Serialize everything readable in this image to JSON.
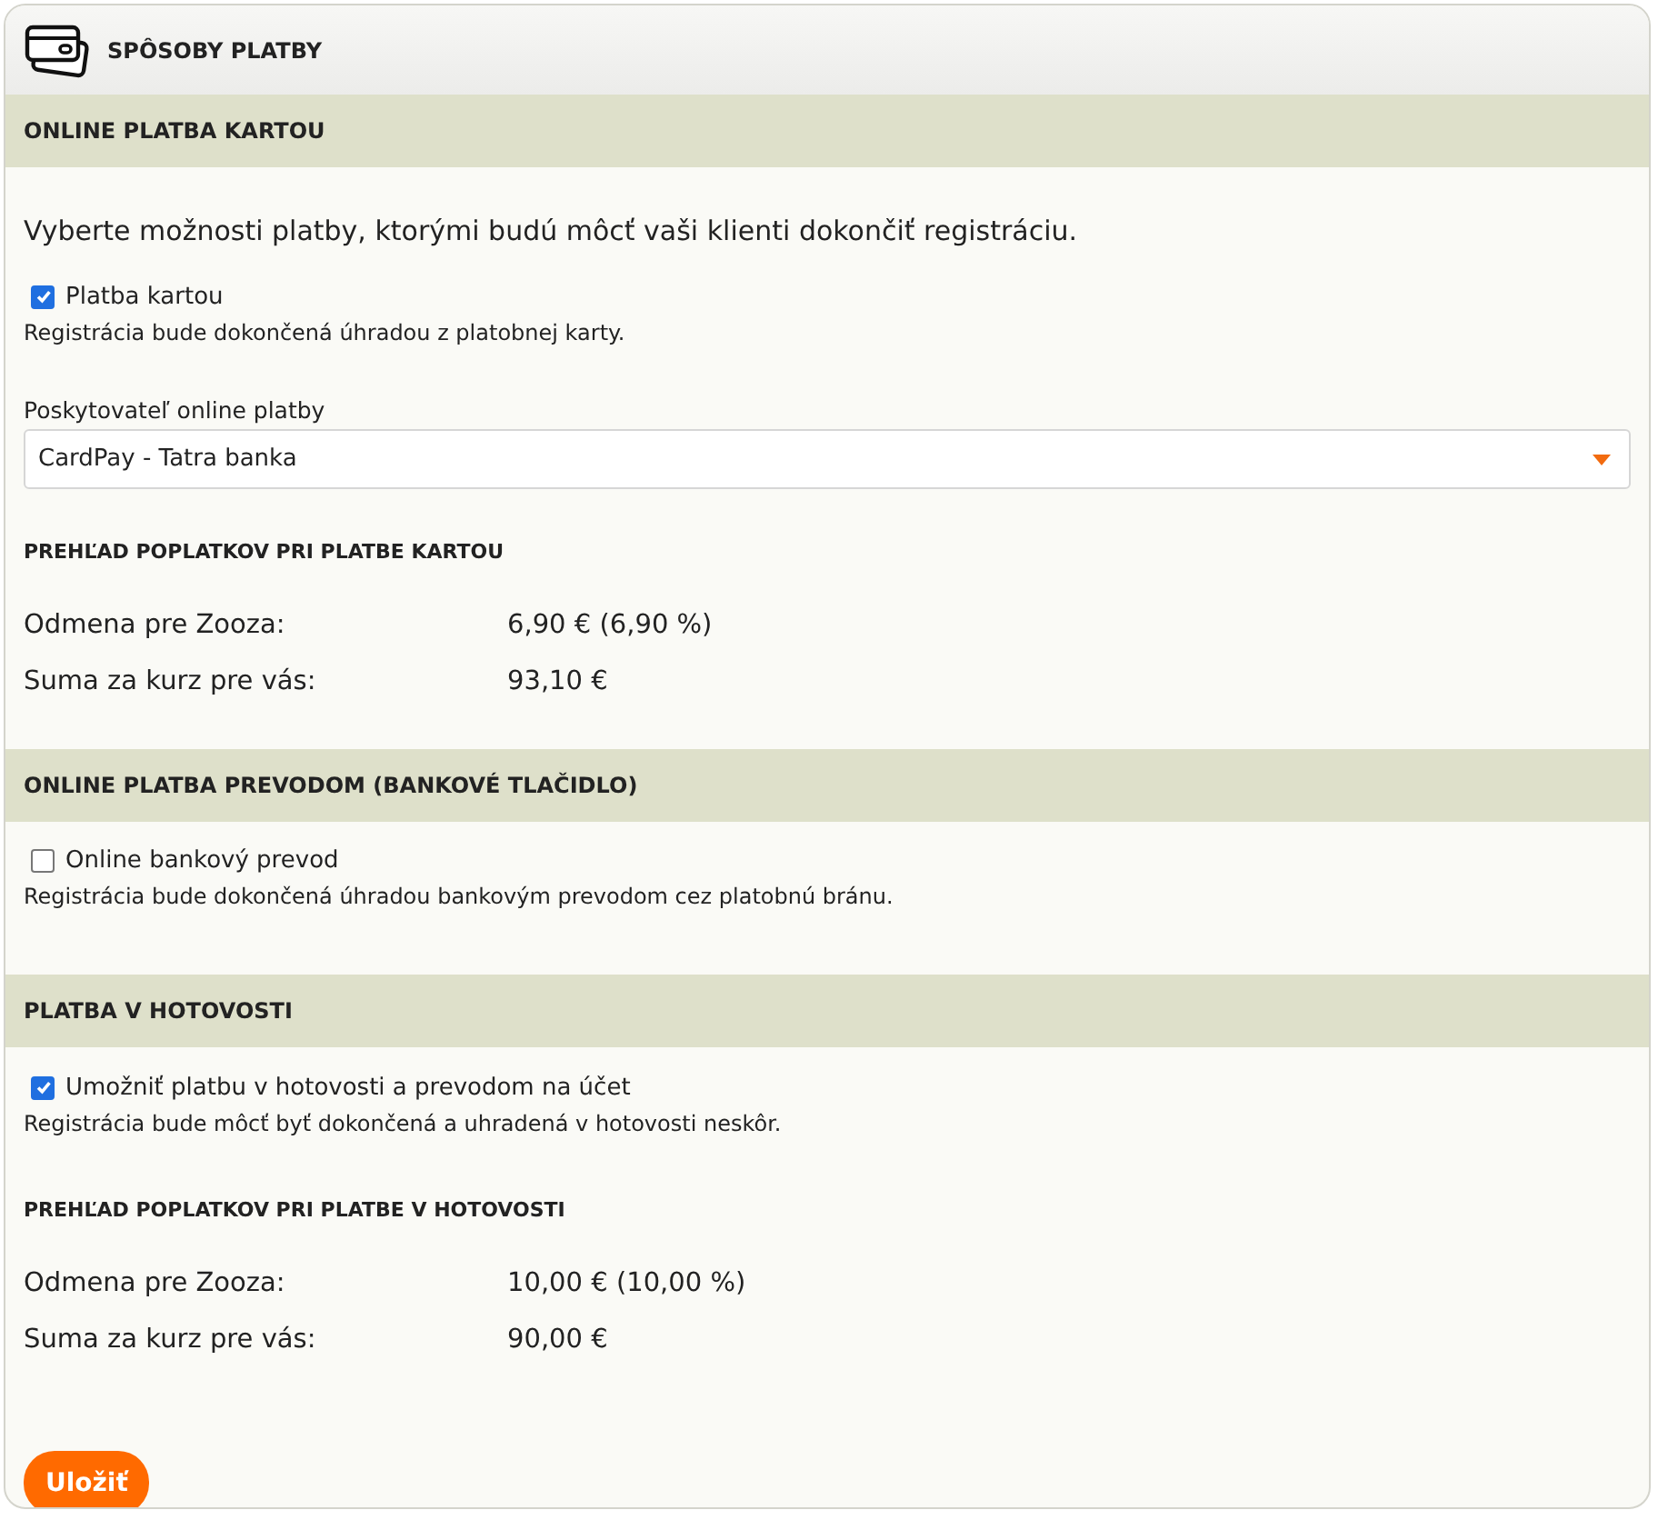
{
  "title": "SPÔSOBY PLATBY",
  "sections": [
    {
      "title": "ONLINE PLATBA KARTOU",
      "intro": "Vyberte možnosti platby, ktorými budú môcť vaši klienti dokončiť registráciu.",
      "option": {
        "label": "Platba kartou",
        "checked": true,
        "description": "Registrácia bude dokončená úhradou z platobnej karty."
      },
      "provider": {
        "label": "Poskytovateľ online platby",
        "value": "CardPay - Tatra banka"
      },
      "fees": {
        "title": "PREHĽAD POPLATKOV PRI PLATBE KARTOU",
        "rows": [
          {
            "label": "Odmena pre Zooza:",
            "value": "6,90 € (6,90 %)"
          },
          {
            "label": "Suma za kurz pre vás:",
            "value": "93,10 €"
          }
        ]
      }
    },
    {
      "title": "ONLINE PLATBA PREVODOM (BANKOVÉ TLAČIDLO)",
      "option": {
        "label": "Online bankový prevod",
        "checked": false,
        "description": "Registrácia bude dokončená úhradou bankovým prevodom cez platobnú bránu."
      }
    },
    {
      "title": "PLATBA V HOTOVOSTI",
      "option": {
        "label": "Umožniť platbu v hotovosti a prevodom na účet",
        "checked": true,
        "description": "Registrácia bude môcť byť dokončená a uhradená v hotovosti neskôr."
      },
      "fees": {
        "title": "PREHĽAD POPLATKOV PRI PLATBE V HOTOVOSTI",
        "rows": [
          {
            "label": "Odmena pre Zooza:",
            "value": "10,00 € (10,00 %)"
          },
          {
            "label": "Suma za kurz pre vás:",
            "value": "90,00 €"
          }
        ]
      }
    }
  ],
  "save_button": "Uložiť"
}
